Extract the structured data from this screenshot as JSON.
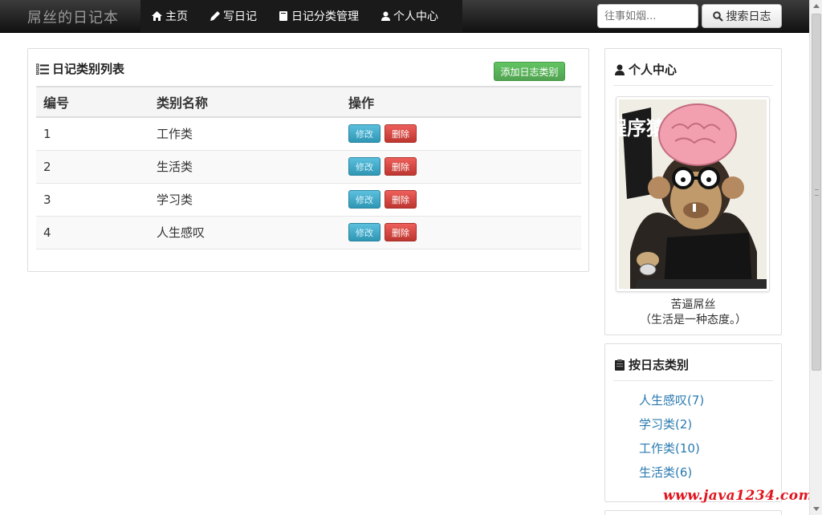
{
  "navbar": {
    "brand": "屌丝的日记本",
    "items": [
      {
        "label": "主页",
        "icon": "home-icon"
      },
      {
        "label": "写日记",
        "icon": "pencil-icon"
      },
      {
        "label": "日记分类管理",
        "icon": "book-icon"
      },
      {
        "label": "个人中心",
        "icon": "user-icon"
      }
    ],
    "search_placeholder": "往事如烟...",
    "search_button": "搜索日志"
  },
  "main": {
    "title": "日记类别列表",
    "add_button": "添加日志类别",
    "columns": [
      "编号",
      "类别名称",
      "操作"
    ],
    "rows": [
      {
        "id": "1",
        "name": "工作类"
      },
      {
        "id": "2",
        "name": "生活类"
      },
      {
        "id": "3",
        "name": "学习类"
      },
      {
        "id": "4",
        "name": "人生感叹"
      }
    ],
    "edit_label": "修改",
    "delete_label": "删除"
  },
  "profile": {
    "title": "个人中心",
    "avatar_text": "程序猿",
    "nickname": "苦逼屌丝",
    "motto": "（生活是一种态度。）"
  },
  "categories": {
    "title": "按日志类别",
    "items": [
      "人生感叹(7)",
      "学习类(2)",
      "工作类(10)",
      "生活类(6)"
    ]
  },
  "watermark": "www.java1234.com",
  "colors": {
    "navbar_bg": "#1b1b1b",
    "success": "#51a351",
    "info": "#2f96b4",
    "danger": "#bd362f",
    "link": "#2a7ab0",
    "watermark": "#e0141e"
  }
}
